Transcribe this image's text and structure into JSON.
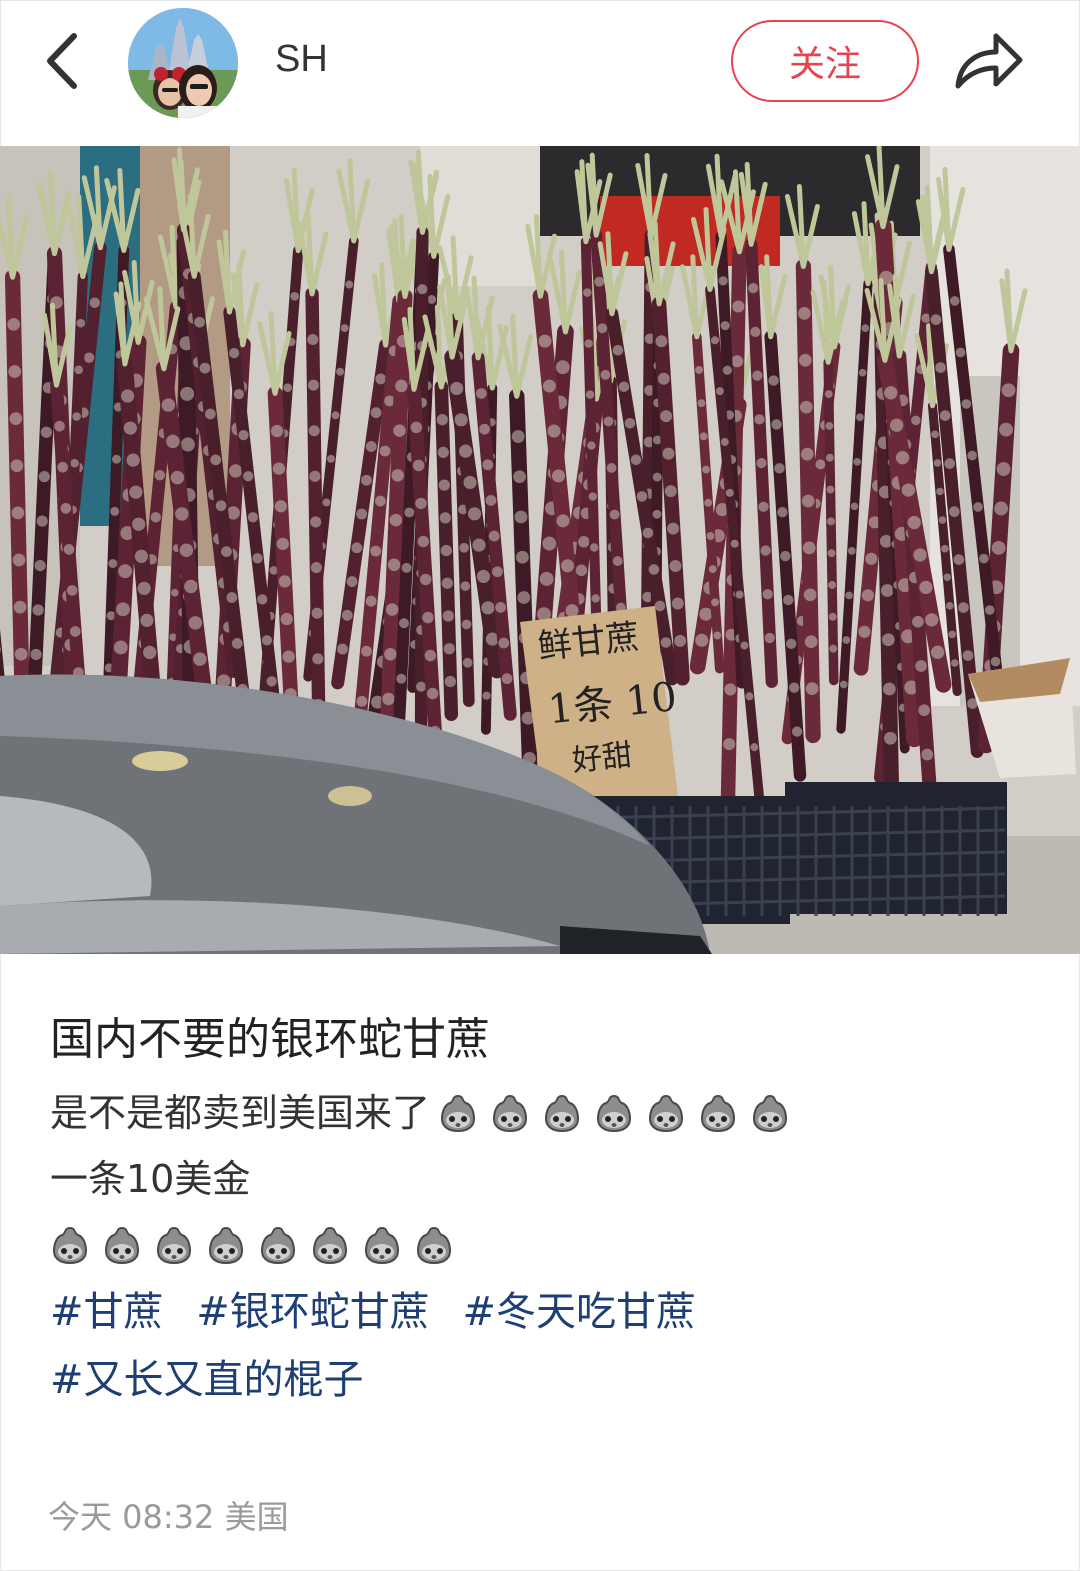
{
  "header": {
    "back_icon": "chevron-left-icon",
    "username": "SH",
    "follow_label": "关注",
    "share_icon": "share-arrow-icon",
    "accent_color": "#e8424f"
  },
  "photo": {
    "sign": {
      "line1": "鲜甘蔗",
      "line2": "1条 10",
      "line3": "好甜"
    }
  },
  "post": {
    "title": "国内不要的银环蛇甘蔗",
    "line1_text": "是不是都卖到美国来了",
    "line1_emoji_count": 7,
    "line2_text": "一条10美金",
    "line3_emoji_count": 8,
    "emoji_icon": "grey-doll-face-emoji",
    "tags": [
      [
        "#甘蔗",
        "#银环蛇甘蔗",
        "#冬天吃甘蔗"
      ],
      [
        "#又长又直的棍子"
      ]
    ],
    "tag_color": "#1e3f73"
  },
  "meta": {
    "time": "今天 08:32",
    "location": "美国"
  }
}
